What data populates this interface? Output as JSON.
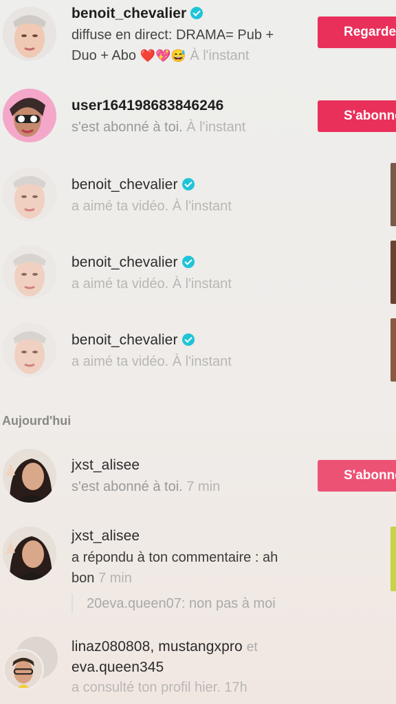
{
  "notifications": [
    {
      "username": "benoit_chevalier",
      "verified": true,
      "text": "diffuse en direct: DRAMA= Pub + Duo + Abo",
      "emoji": "❤️💖😅",
      "time": "À l'instant",
      "button": "Regarder"
    },
    {
      "username": "user164198683846246",
      "verified": false,
      "text": "s'est abonné à toi.",
      "time": "À l'instant",
      "button": "S'abonner"
    },
    {
      "username": "benoit_chevalier",
      "verified": true,
      "text": "a aimé ta vidéo.",
      "time": "À l'instant"
    },
    {
      "username": "benoit_chevalier",
      "verified": true,
      "text": "a aimé ta vidéo.",
      "time": "À l'instant"
    },
    {
      "username": "benoit_chevalier",
      "verified": true,
      "text": "a aimé ta vidéo.",
      "time": "À l'instant"
    }
  ],
  "section_today": "Aujourd'hui",
  "today": [
    {
      "username": "jxst_alisee",
      "text": "s'est abonné à toi.",
      "time": "7 min",
      "button": "S'abonner"
    },
    {
      "username": "jxst_alisee",
      "text_line1": "a répondu à ton commentaire : ah",
      "text_line2": "bon",
      "time": "7 min",
      "quote": "20eva.queen07: non pas à moi"
    },
    {
      "user1": "linaz080808",
      "sep": ",",
      "user2": "mustangxpro",
      "conj": "et",
      "user3": "eva.queen345",
      "text": "a consulté ton profil hier.",
      "time": "17h"
    }
  ],
  "colors": {
    "accent": "#e9305a",
    "verified": "#20c4d8"
  }
}
